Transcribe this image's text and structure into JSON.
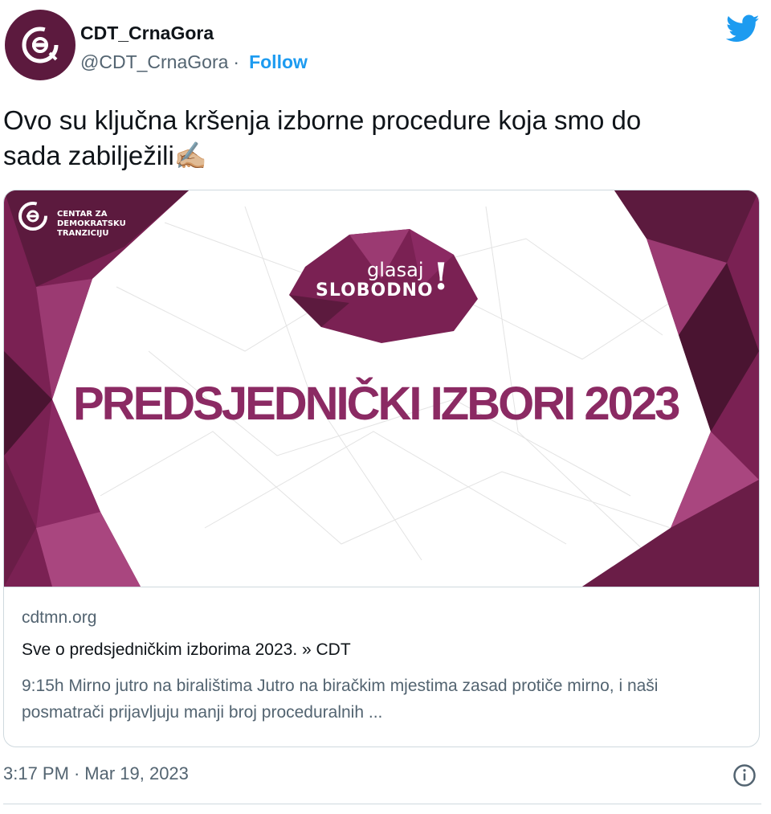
{
  "tweet": {
    "display_name": "CDT_CrnaGora",
    "handle": "@CDT_CrnaGora",
    "separator": "·",
    "follow_label": "Follow",
    "text_line1": "Ovo su ključna kršenja izborne procedure koja smo do",
    "text_line2": "sada zabilježili",
    "emoji": "✍🏼",
    "time": "3:17 PM",
    "date": "Mar 19, 2023"
  },
  "card": {
    "logo_text": [
      "CENTAR ZA",
      "DEMOKRATSKU",
      "TRANZICIJU"
    ],
    "badge_top": "glasaj",
    "badge_bottom": "SLOBODNO",
    "badge_mark": "!",
    "headline": "PREDSJEDNIČKI IZBORI 2023",
    "domain": "cdtmn.org",
    "title": "Sve o predsjedničkim izborima 2023. » CDT",
    "description": "9:15h Mirno jutro na biralištima  Jutro na biračkim mjestima zasad protiče mirno, i naši posmatrači prijavljuju manji broj proceduralnih ..."
  },
  "icons": {
    "brand": "twitter-bird-icon",
    "info": "info-icon"
  },
  "colors": {
    "brand_purple": "#8b2a63",
    "dark_purple": "#5c1a3e",
    "link_blue": "#1d9bf0",
    "muted": "#536471"
  }
}
